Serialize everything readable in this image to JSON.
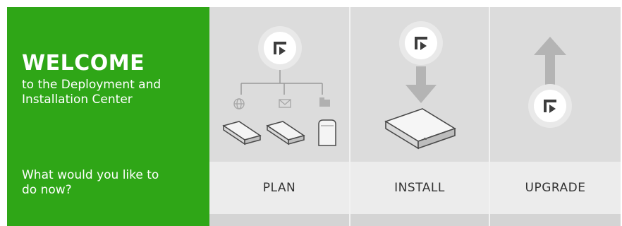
{
  "welcome": {
    "title": "WELCOME",
    "subtitle_line1": "to the Deployment and",
    "subtitle_line2": "Installation Center",
    "question_line1": "What would you like to",
    "question_line2": "do now?",
    "background_color": "#2fa617"
  },
  "options": [
    {
      "id": "plan",
      "label": "PLAN",
      "icons": [
        "logo-icon",
        "globe-icon",
        "mail-icon",
        "folder-icon",
        "appliance-icon",
        "appliance-icon",
        "server-tower-icon"
      ]
    },
    {
      "id": "install",
      "label": "INSTALL",
      "icons": [
        "logo-icon",
        "arrow-down-icon",
        "appliance-icon"
      ]
    },
    {
      "id": "upgrade",
      "label": "UPGRADE",
      "icons": [
        "arrow-up-icon",
        "logo-icon"
      ]
    }
  ],
  "colors": {
    "panel_bg": "#dcdcdc",
    "label_bg": "#ececec",
    "label_text": "#333333",
    "icon_dark": "#404040",
    "arrow": "#b4b4b4"
  }
}
